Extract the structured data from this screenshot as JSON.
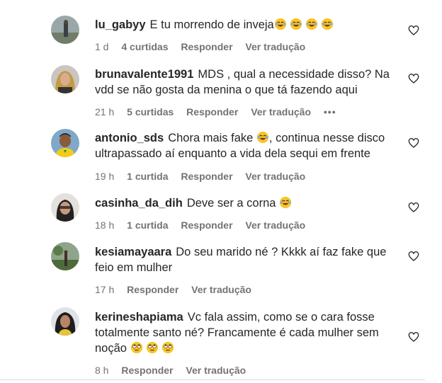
{
  "comments": [
    {
      "username": "lu_gabyy",
      "text": "E tu morrendo de inveja",
      "emojis": [
        "laughing-crying",
        "laughing-crying",
        "laughing-crying",
        "laughing-crying"
      ],
      "time": "1 d",
      "likes": "4 curtidas",
      "reply": "Responder",
      "translate": "Ver tradução"
    },
    {
      "username": "brunavalente1991",
      "text": "MDS , qual a necessidade disso? Na vdd se não gosta da menina o que tá fazendo aqui",
      "emojis": [],
      "time": "21 h",
      "likes": "5 curtidas",
      "reply": "Responder",
      "translate": "Ver tradução",
      "more": "•••"
    },
    {
      "username": "antonio_sds",
      "text": "Chora mais fake",
      "emojis": [
        "laughing-crying"
      ],
      "text_after": ", continua nesse disco ultrapassado aí enquanto a vida dela sequi em frente",
      "time": "19 h",
      "likes": "1 curtida",
      "reply": "Responder",
      "translate": "Ver tradução"
    },
    {
      "username": "casinha_da_dih",
      "text": "Deve ser a corna",
      "emojis": [
        "laughing-crying"
      ],
      "time": "18 h",
      "likes": "1 curtida",
      "reply": "Responder",
      "translate": "Ver tradução"
    },
    {
      "username": "kesiamayaara",
      "text": "Do seu marido né ? Kkkk aí faz fake que feio em mulher",
      "emojis": [],
      "time": "17 h",
      "likes": "",
      "reply": "Responder",
      "translate": "Ver tradução"
    },
    {
      "username": "kerineshapiama",
      "text": "Vc fala assim, como se o cara fosse totalmente santo né? Francamente é cada mulher sem noção",
      "emojis": [
        "rolling-eyes",
        "rolling-eyes",
        "rolling-eyes"
      ],
      "time": "8 h",
      "likes": "",
      "reply": "Responder",
      "translate": "Ver tradução"
    }
  ],
  "colors": {
    "text": "#262626",
    "secondary": "#737373",
    "emoji_face": "#f7c52b"
  }
}
